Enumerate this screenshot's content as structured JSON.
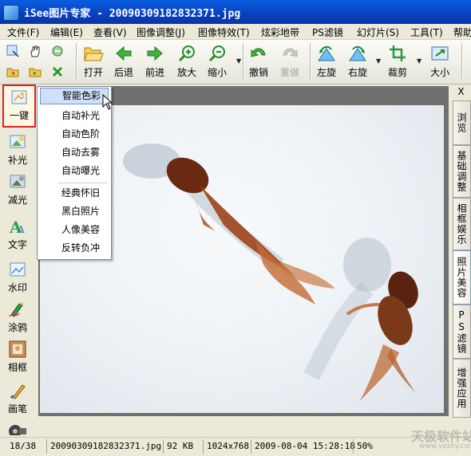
{
  "window": {
    "title": "iSee图片专家 - 20090309182832371.jpg"
  },
  "menu": [
    "文件(F)",
    "编辑(E)",
    "查看(V)",
    "图像调整(J)",
    "图像特效(T)",
    "炫彩地带",
    "PS滤镜",
    "幻灯片(S)",
    "工具(T)",
    "帮助"
  ],
  "toolbar": {
    "small_tools": [
      {
        "name": "select",
        "icon": "select-icon"
      },
      {
        "name": "hand",
        "icon": "hand-icon"
      },
      {
        "name": "browse",
        "icon": "browse-icon"
      },
      {
        "name": "prev",
        "icon": "folder-prev-icon"
      },
      {
        "name": "next",
        "icon": "folder-next-icon"
      },
      {
        "name": "delete",
        "icon": "delete-icon"
      }
    ],
    "buttons": [
      {
        "label": "打开",
        "icon": "open-icon"
      },
      {
        "label": "后退",
        "icon": "back-icon"
      },
      {
        "label": "前进",
        "icon": "forward-icon"
      },
      {
        "label": "放大",
        "icon": "zoom-in-icon"
      },
      {
        "label": "缩小",
        "icon": "zoom-out-icon"
      },
      {
        "label": "撤销",
        "icon": "undo-icon"
      },
      {
        "label": "重做",
        "icon": "redo-icon",
        "disabled": true
      },
      {
        "label": "左旋",
        "icon": "rotate-left-icon"
      },
      {
        "label": "右旋",
        "icon": "rotate-right-icon"
      },
      {
        "label": "裁剪",
        "icon": "crop-icon"
      },
      {
        "label": "大小",
        "icon": "resize-icon"
      }
    ]
  },
  "left_tools": [
    {
      "label": "一键",
      "icon": "magic-icon",
      "active": true
    },
    {
      "label": "补光",
      "icon": "fill-light-icon"
    },
    {
      "label": "减光",
      "icon": "reduce-light-icon"
    },
    {
      "label": "文字",
      "icon": "text-icon"
    },
    {
      "label": "水印",
      "icon": "watermark-icon"
    },
    {
      "label": "涂鸦",
      "icon": "doodle-icon"
    },
    {
      "label": "相框",
      "icon": "frame-icon"
    },
    {
      "label": "画笔",
      "icon": "brush-icon"
    }
  ],
  "popup_menu": {
    "group1": [
      "智能色彩",
      "自动补光",
      "自动色阶",
      "自动去雾",
      "自动曝光"
    ],
    "group2": [
      "经典怀旧",
      "黑白照片",
      "人像美容",
      "反转负冲"
    ],
    "highlighted": "智能色彩"
  },
  "right_panel": {
    "close": "X",
    "tabs": [
      {
        "label": "浏览"
      },
      {
        "label": "基础调整"
      },
      {
        "label": "相框娱乐"
      },
      {
        "label": "照片美容",
        "active": true
      },
      {
        "label": "PS滤镜"
      },
      {
        "label": "增强应用"
      }
    ]
  },
  "status": {
    "index": "18/38",
    "filename": "20090309182832371.jpg",
    "size": "92 KB",
    "dimensions": "1024x768",
    "datetime": "2009-08-04 15:28:18",
    "zoom": "50%"
  },
  "watermark": {
    "text": "天极软件站",
    "sub": "www.yesky.com"
  },
  "colors": {
    "title_bar": "#0a4fd0",
    "active_outline": "#e02020",
    "highlight": "#cfe0f8"
  }
}
